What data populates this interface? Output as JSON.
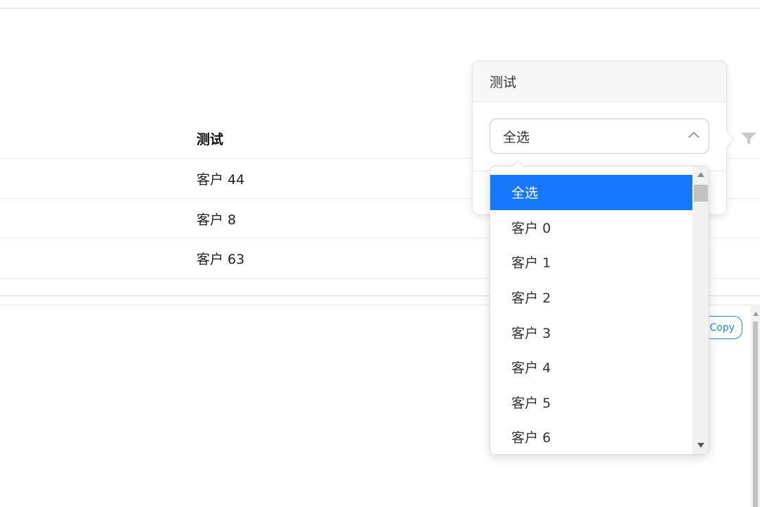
{
  "table": {
    "column_header": "测试",
    "rows": [
      {
        "value": "客户 44"
      },
      {
        "value": "客户 8"
      },
      {
        "value": "客户 63"
      }
    ]
  },
  "copy_button": {
    "label": "Copy"
  },
  "filter_popup": {
    "title": "测试",
    "select": {
      "value": "全选"
    },
    "options": [
      "全选",
      "客户 0",
      "客户 1",
      "客户 2",
      "客户 3",
      "客户 4",
      "客户 5",
      "客户 6"
    ],
    "selected_index": 0
  },
  "colors": {
    "accent": "#1677ff",
    "copy_button": "#1e88e5"
  },
  "icons": {
    "filter": "filter-icon",
    "select_toggle": "chevron-up-icon"
  }
}
